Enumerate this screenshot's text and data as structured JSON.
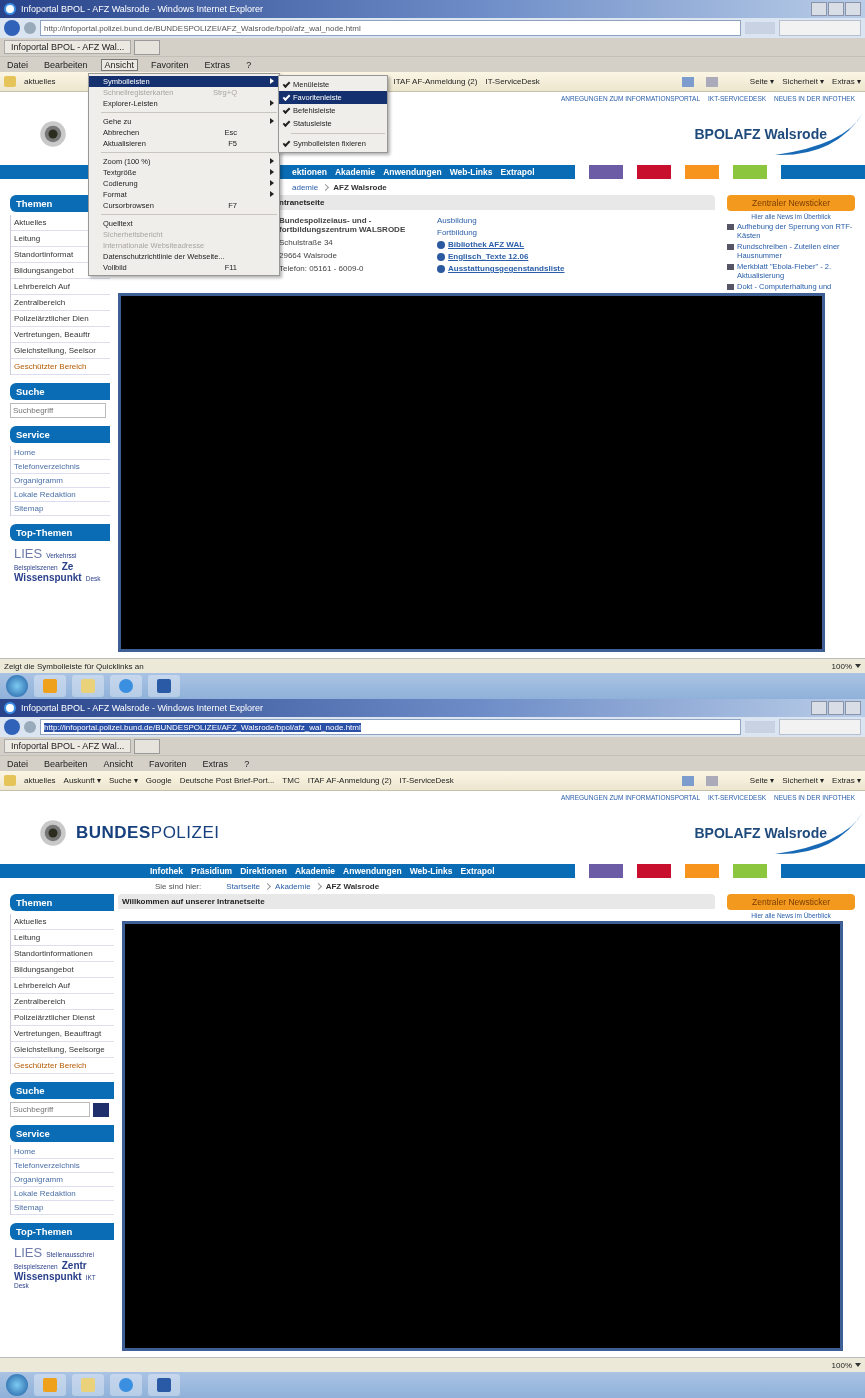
{
  "screens": [
    {
      "title": "Infoportal BPOL - AFZ Walsrode - Windows Internet Explorer",
      "url": "http://infoportal.polizei.bund.de/BUNDESPOLIZEI/AFZ_Walsrode/bpol/afz_wal_node.html",
      "url_selected": false,
      "tab": "Infoportal BPOL - AFZ Wal...",
      "menubar": [
        {
          "label": "Datei",
          "selected": false
        },
        {
          "label": "Bearbeiten",
          "selected": false
        },
        {
          "label": "Ansicht",
          "selected": true
        },
        {
          "label": "Favoriten",
          "selected": false
        },
        {
          "label": "Extras",
          "selected": false
        },
        {
          "label": "?",
          "selected": false
        }
      ],
      "favorites": [
        "aktuelles",
        "ITAF AF-Anmeldung (2)",
        "IT-ServiceDesk"
      ],
      "commands": [
        "Seite ▾",
        "Sicherheit ▾",
        "Extras ▾"
      ],
      "top_links": [
        "ANREGUNGEN ZUM INFORMATIONSPORTAL",
        "IKT-SERVICEDESK",
        "NEUES IN DER INFOTHEK"
      ],
      "site_title": "BPOLAFZ Walsrode",
      "nav": [
        "ektionen",
        "Akademie",
        "Anwendungen",
        "Web-Links",
        "Extrapol"
      ],
      "color_tabs": [
        {
          "color": "#6b5ca5"
        },
        {
          "color": "#c8102e"
        },
        {
          "color": "#f7941d"
        },
        {
          "color": "#8cc63f"
        },
        {
          "color": "#0a6cb4"
        }
      ],
      "breadcrumb": [
        "ademie",
        "AFZ Walsrode"
      ],
      "content_heading": "ntranetseite",
      "address": [
        "Bundespolizeiaus- und -fortbildungszentrum WALSRODE",
        "Schulstraße 34",
        "29664 Walsrode",
        "Telefon: 05161 - 6009-0"
      ],
      "content_links": [
        {
          "label": "Ausbildung",
          "kind": "plain"
        },
        {
          "label": "Fortbildung",
          "kind": "plain"
        },
        {
          "label": "Bibliothek AFZ WAL",
          "kind": "globe"
        },
        {
          "label": "Englisch_Texte 12.06",
          "kind": "globe"
        },
        {
          "label": "Ausstattungsgegenstandsliste",
          "kind": "globe"
        }
      ],
      "newsticker": {
        "heading": "Zentraler Newsticker",
        "subheading": "Hier alle News im Überblick",
        "items": [
          "Aufhebung der Sperrung von RTF-Kästen",
          "Rundschreiben - Zuteilen einer Hausnummer",
          "Merkblatt \"Ebola-Fieber\" - 2. Aktualisierung",
          "Dokt - Computerhaltung und"
        ]
      },
      "sidebar": {
        "themen_heading": "Themen",
        "themen": [
          "Aktuelles",
          "Leitung",
          "Standortinformat",
          "Bildungsangebot",
          "Lehrbereich Auf",
          "Zentralbereich",
          "Polizeiärztlicher Dien",
          "Vertretungen, Beauftr",
          "Gleichstellung, Seelsor",
          "Geschützter Bereich"
        ],
        "suche_heading": "Suche",
        "search_placeholder": "Suchbegriff",
        "search_button": false,
        "service_heading": "Service",
        "service": [
          "Home",
          "Telefonverzeichnis",
          "Organigramm",
          "Lokale Redaktion",
          "Sitemap"
        ],
        "top_heading": "Top-Themen",
        "cloud": [
          {
            "label": "LIES",
            "kind": "large"
          },
          {
            "label": "Verkehrssi",
            "kind": "small"
          },
          {
            "label": "Beispielszenen",
            "kind": "small"
          },
          {
            "label": "Ze",
            "kind": "medium"
          },
          {
            "label": "Wissenspunkt",
            "kind": "medium"
          },
          {
            "label": "Desk",
            "kind": "small"
          }
        ]
      },
      "menu": {
        "items": [
          {
            "label": "Symbolleisten",
            "kind": "item",
            "submenu": true,
            "selected": true,
            "disabled": false
          },
          {
            "label": "Schnellregisterkarten",
            "shortcut": "Strg+Q",
            "kind": "item",
            "submenu": false,
            "selected": false,
            "disabled": true
          },
          {
            "label": "Explorer-Leisten",
            "kind": "item",
            "submenu": true,
            "selected": false,
            "disabled": false
          },
          {
            "kind": "separator"
          },
          {
            "label": "Gehe zu",
            "kind": "item",
            "submenu": true,
            "selected": false,
            "disabled": false
          },
          {
            "label": "Abbrechen",
            "shortcut": "Esc",
            "kind": "item",
            "submenu": false,
            "selected": false,
            "disabled": false
          },
          {
            "label": "Aktualisieren",
            "shortcut": "F5",
            "kind": "item",
            "submenu": false,
            "selected": false,
            "disabled": false
          },
          {
            "kind": "separator"
          },
          {
            "label": "Zoom (100 %)",
            "kind": "item",
            "submenu": true,
            "selected": false,
            "disabled": false
          },
          {
            "label": "Textgröße",
            "kind": "item",
            "submenu": true,
            "selected": false,
            "disabled": false
          },
          {
            "label": "Codierung",
            "kind": "item",
            "submenu": true,
            "selected": false,
            "disabled": false
          },
          {
            "label": "Format",
            "kind": "item",
            "submenu": true,
            "selected": false,
            "disabled": false
          },
          {
            "label": "Cursorbrowsen",
            "shortcut": "F7",
            "kind": "item",
            "submenu": false,
            "selected": false,
            "disabled": false
          },
          {
            "kind": "separator"
          },
          {
            "label": "Quelltext",
            "kind": "item",
            "submenu": false,
            "selected": false,
            "disabled": false
          },
          {
            "label": "Sicherheitsbericht",
            "kind": "item",
            "submenu": false,
            "selected": false,
            "disabled": true
          },
          {
            "label": "Internationale Websiteadresse",
            "kind": "item",
            "submenu": false,
            "selected": false,
            "disabled": true
          },
          {
            "label": "Datenschutzrichtlinie der Webseite...",
            "kind": "item",
            "submenu": false,
            "selected": false,
            "disabled": false
          },
          {
            "label": "Vollbild",
            "shortcut": "F11",
            "kind": "item",
            "submenu": false,
            "selected": false,
            "disabled": false
          }
        ],
        "submenu": [
          {
            "label": "Menüleiste",
            "kind": "item",
            "checked": true,
            "selected": false
          },
          {
            "label": "Favoritenleiste",
            "kind": "item",
            "checked": true,
            "selected": true
          },
          {
            "label": "Befehlsleiste",
            "kind": "item",
            "checked": true,
            "selected": false
          },
          {
            "label": "Statusleiste",
            "kind": "item",
            "checked": true,
            "selected": false
          },
          {
            "kind": "separator"
          },
          {
            "label": "Symbolleisten fixieren",
            "kind": "item",
            "checked": true,
            "selected": false
          }
        ]
      },
      "status_text": "Zeigt die Symbolleiste für Quicklinks an",
      "zoom": "100%"
    },
    {
      "title": "Infoportal BPOL - AFZ Walsrode - Windows Internet Explorer",
      "url": "http://infoportal.polizei.bund.de/BUNDESPOLIZEI/AFZ_Walsrode/bpol/afz_wal_node.html",
      "url_selected": true,
      "tab": "Infoportal BPOL - AFZ Wal...",
      "menubar": [
        {
          "label": "Datei",
          "selected": false
        },
        {
          "label": "Bearbeiten",
          "selected": false
        },
        {
          "label": "Ansicht",
          "selected": false
        },
        {
          "label": "Favoriten",
          "selected": false
        },
        {
          "label": "Extras",
          "selected": false
        },
        {
          "label": "?",
          "selected": false
        }
      ],
      "favorites": [
        "aktuelles",
        "Auskunft ▾",
        "Suche ▾",
        "Google",
        "Deutsche Post Brief-Port...",
        "TMC",
        "ITAF AF-Anmeldung (2)",
        "IT-ServiceDesk"
      ],
      "commands": [
        "Seite ▾",
        "Sicherheit ▾",
        "Extras ▾"
      ],
      "top_links": [
        "ANREGUNGEN ZUM INFORMATIONSPORTAL",
        "IKT-SERVICEDESK",
        "NEUES IN DER INFOTHEK"
      ],
      "wordmark": "**BUNDES**POLIZEI",
      "site_title": "BPOLAFZ Walsrode",
      "nav": [
        "Infothek",
        "Präsidium",
        "Direktionen",
        "Akademie",
        "Anwendungen",
        "Web-Links",
        "Extrapol"
      ],
      "color_tabs": [
        {
          "color": "#6b5ca5"
        },
        {
          "color": "#c8102e"
        },
        {
          "color": "#f7941d"
        },
        {
          "color": "#8cc63f"
        },
        {
          "color": "#0a6cb4"
        }
      ],
      "breadcrumb_label": "Sie sind hier:",
      "breadcrumb": [
        "Startseite",
        "Akademie",
        "AFZ Walsrode"
      ],
      "content_heading": "Willkommen auf unserer Intranetseite",
      "newsticker": {
        "heading": "Zentraler Newsticker",
        "subheading": "Hier alle News im Überblick"
      },
      "sidebar": {
        "themen_heading": "Themen",
        "themen": [
          "Aktuelles",
          "Leitung",
          "Standortinformationen",
          "Bildungsangebot",
          "Lehrbereich Auf",
          "Zentralbereich",
          "Polizeiärztlicher Dienst",
          "Vertretungen, Beauftragt",
          "Gleichstellung, Seelsorge",
          "Geschützter Bereich"
        ],
        "suche_heading": "Suche",
        "search_placeholder": "Suchbegriff",
        "search_button": true,
        "service_heading": "Service",
        "service": [
          "Home",
          "Telefonverzeichnis",
          "Organigramm",
          "Lokale Redaktion",
          "Sitemap"
        ],
        "top_heading": "Top-Themen",
        "cloud": [
          {
            "label": "LIES",
            "kind": "large"
          },
          {
            "label": "Stellenausschrei",
            "kind": "small"
          },
          {
            "label": "Beispielszenen",
            "kind": "small"
          },
          {
            "label": "Zentr",
            "kind": "medium"
          },
          {
            "label": "Wissenspunkt",
            "kind": "medium"
          },
          {
            "label": "IKT",
            "kind": "small"
          },
          {
            "label": "Desk",
            "kind": "small"
          }
        ]
      },
      "zoom": "100%"
    }
  ]
}
